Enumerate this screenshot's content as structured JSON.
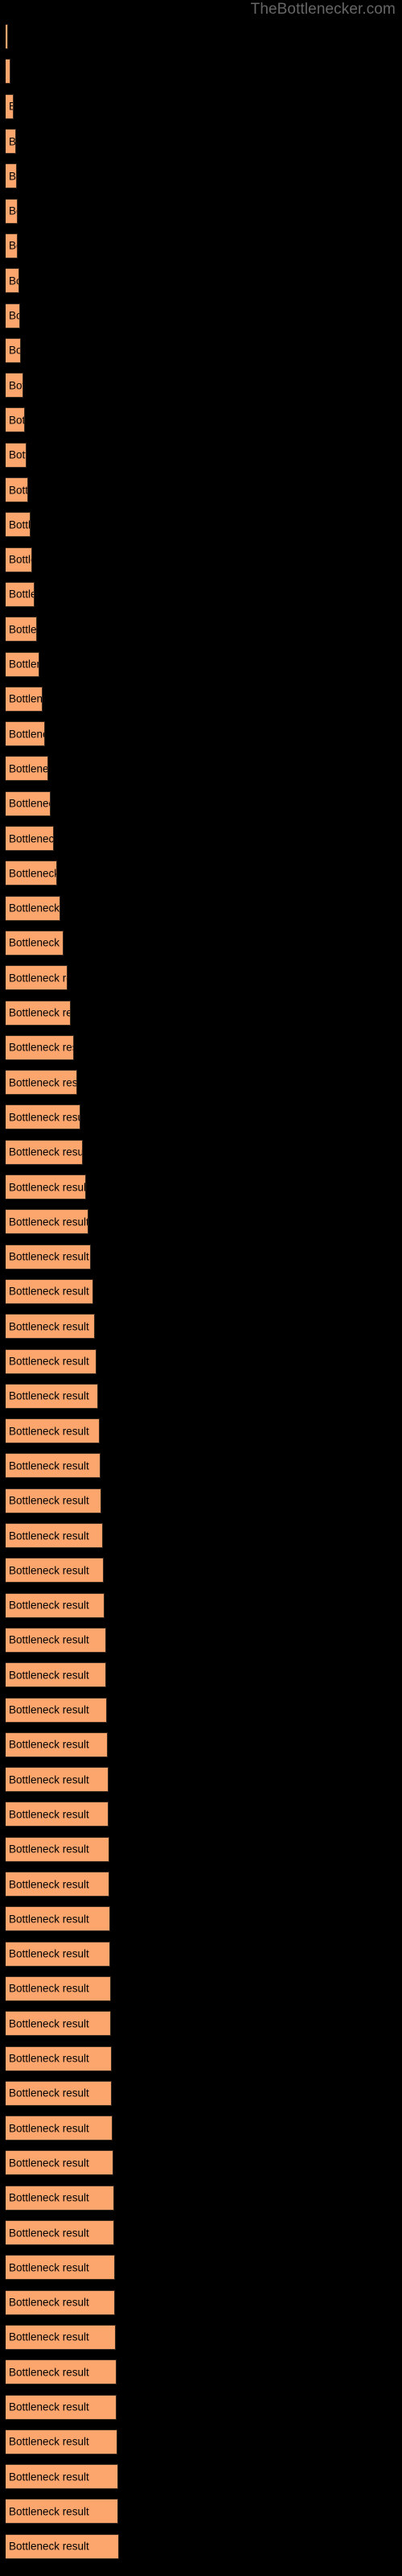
{
  "watermark": "TheBottlenecker.com",
  "colors": {
    "background": "#000000",
    "bar_fill": "#fca56d",
    "bar_edge": "#3a2a1e",
    "label_text": "#000000",
    "watermark_text": "#666666"
  },
  "chart_data": {
    "type": "bar",
    "orientation": "horizontal",
    "title": "",
    "subtitle": "",
    "xlabel": "",
    "ylabel": "",
    "grid": false,
    "legend": false,
    "axis_visible": false,
    "tick_labels_x": [],
    "tick_labels_y": [],
    "xlim": [
      0,
      140
    ],
    "bar_label_text": "Bottleneck result",
    "categories": [
      "Bottleneck result",
      "Bottleneck result",
      "Bottleneck result",
      "Bottleneck result",
      "Bottleneck result",
      "Bottleneck result",
      "Bottleneck result",
      "Bottleneck result",
      "Bottleneck result",
      "Bottleneck result",
      "Bottleneck result",
      "Bottleneck result",
      "Bottleneck result",
      "Bottleneck result",
      "Bottleneck result",
      "Bottleneck result",
      "Bottleneck result",
      "Bottleneck result",
      "Bottleneck result",
      "Bottleneck result",
      "Bottleneck result",
      "Bottleneck result",
      "Bottleneck result",
      "Bottleneck result",
      "Bottleneck result",
      "Bottleneck result",
      "Bottleneck result",
      "Bottleneck result",
      "Bottleneck result",
      "Bottleneck result",
      "Bottleneck result",
      "Bottleneck result",
      "Bottleneck result",
      "Bottleneck result",
      "Bottleneck result",
      "Bottleneck result",
      "Bottleneck result",
      "Bottleneck result",
      "Bottleneck result",
      "Bottleneck result",
      "Bottleneck result",
      "Bottleneck result",
      "Bottleneck result",
      "Bottleneck result",
      "Bottleneck result",
      "Bottleneck result",
      "Bottleneck result",
      "Bottleneck result",
      "Bottleneck result",
      "Bottleneck result",
      "Bottleneck result",
      "Bottleneck result",
      "Bottleneck result",
      "Bottleneck result",
      "Bottleneck result",
      "Bottleneck result",
      "Bottleneck result",
      "Bottleneck result",
      "Bottleneck result",
      "Bottleneck result",
      "Bottleneck result",
      "Bottleneck result",
      "Bottleneck result",
      "Bottleneck result",
      "Bottleneck result",
      "Bottleneck result",
      "Bottleneck result",
      "Bottleneck result",
      "Bottleneck result",
      "Bottleneck result",
      "Bottleneck result",
      "Bottleneck result",
      "Bottleneck result"
    ],
    "values": [
      2,
      4,
      7,
      9,
      10,
      11,
      11,
      12,
      13,
      14,
      16,
      17,
      19,
      20,
      22,
      24,
      26,
      28,
      30,
      33,
      35,
      38,
      40,
      43,
      46,
      49,
      52,
      55,
      58,
      61,
      64,
      67,
      69,
      72,
      74,
      76,
      78,
      80,
      81,
      83,
      84,
      85,
      86,
      87,
      88,
      89,
      90,
      90,
      91,
      91,
      92,
      92,
      93,
      93,
      94,
      94,
      95,
      95,
      96,
      96,
      96,
      97,
      97,
      97,
      98,
      98,
      98,
      99,
      99,
      99,
      100,
      100,
      100
    ],
    "value_unit": "relative",
    "bar_pixel_widths": [
      3,
      6,
      10,
      13,
      14,
      15,
      15,
      17,
      18,
      19,
      22,
      24,
      26,
      28,
      31,
      33,
      36,
      39,
      42,
      46,
      49,
      53,
      56,
      60,
      64,
      68,
      72,
      77,
      81,
      85,
      89,
      93,
      96,
      100,
      103,
      106,
      109,
      111,
      113,
      115,
      117,
      118,
      119,
      121,
      122,
      123,
      125,
      125,
      126,
      127,
      128,
      128,
      129,
      129,
      130,
      130,
      131,
      131,
      132,
      132,
      133,
      134,
      135,
      135,
      136,
      136,
      137,
      138,
      138,
      139,
      140,
      140,
      141
    ]
  }
}
